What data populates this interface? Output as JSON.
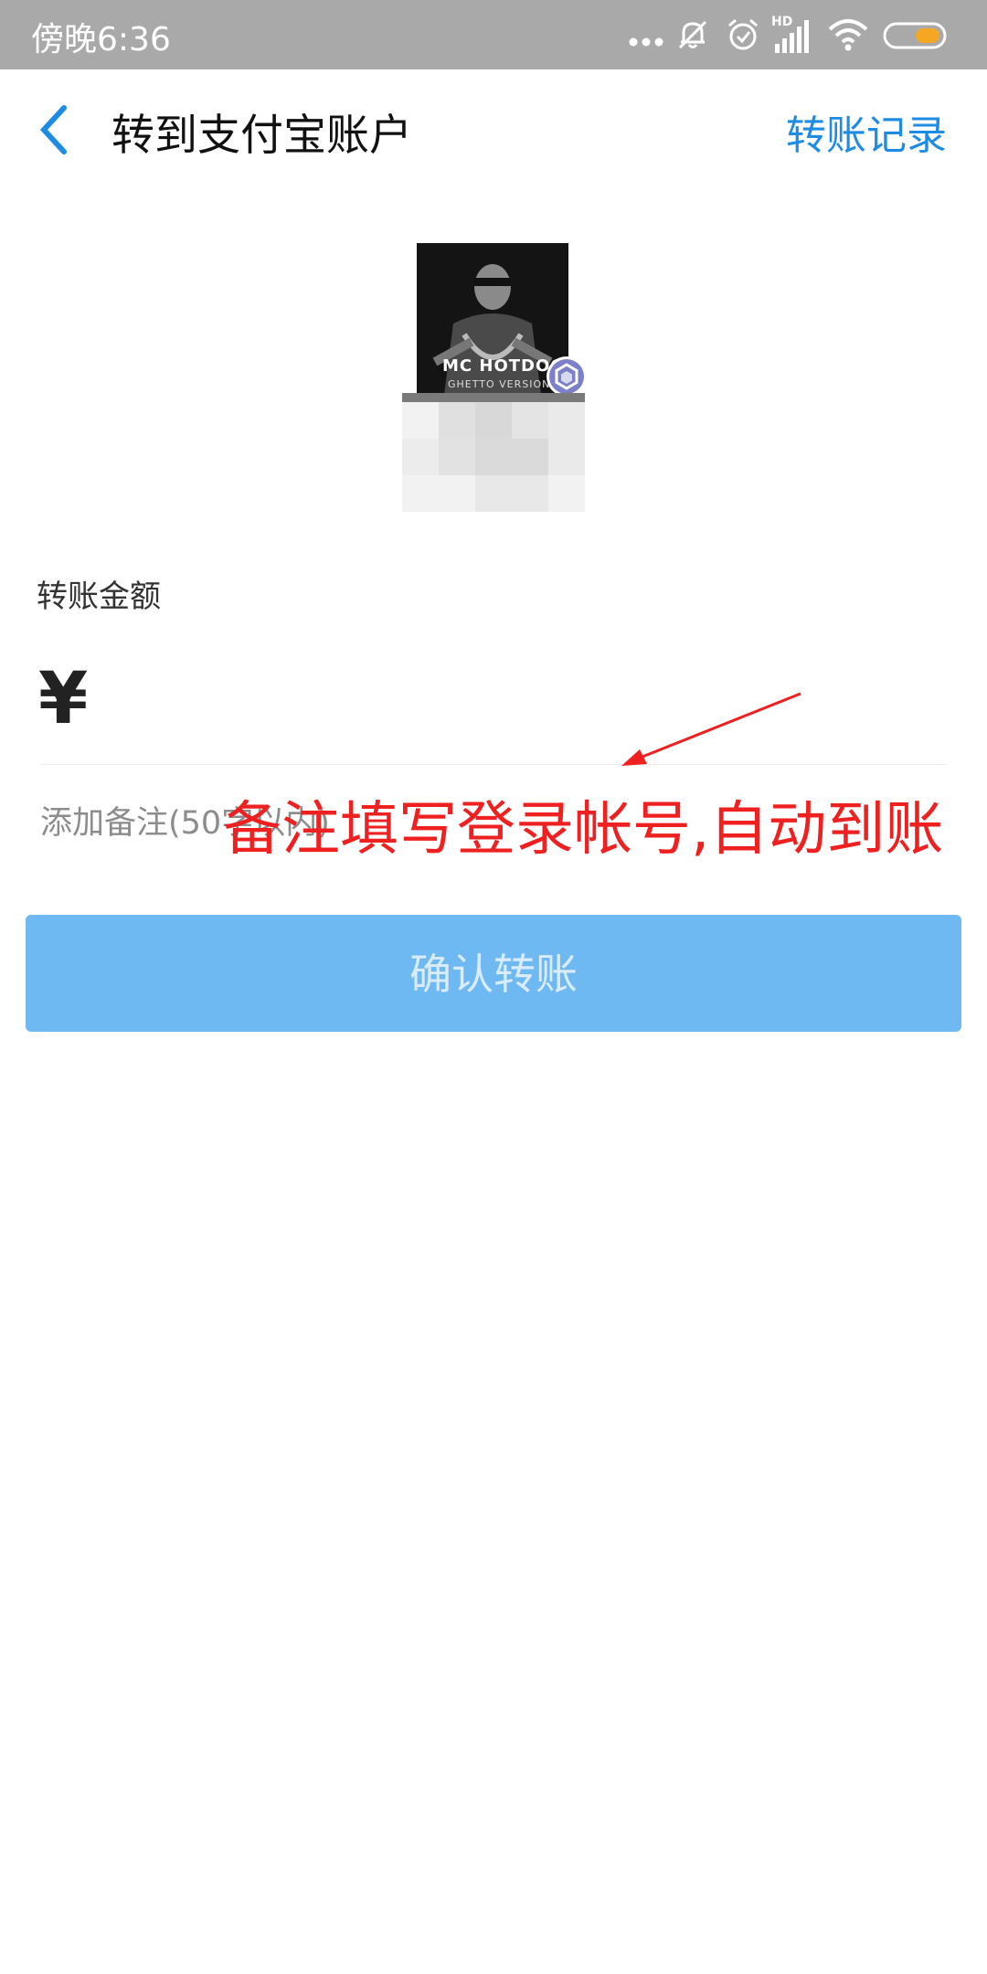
{
  "status_bar": {
    "time": "傍晚6:36",
    "icons": [
      "more-dots-icon",
      "bell-muted-icon",
      "alarm-icon",
      "hd-signal-icon",
      "wifi-icon",
      "battery-icon"
    ],
    "hd_label": "HD"
  },
  "nav": {
    "back_icon": "chevron-left-icon",
    "title": "转到支付宝账户",
    "records_link": "转账记录",
    "accent_color": "#1f8ce3"
  },
  "recipient": {
    "avatar_text_main": "MC HOTDOG",
    "avatar_text_sub": "GHETTO VERSION",
    "badge_icon": "verified-badge-icon"
  },
  "form": {
    "amount_label": "转账金额",
    "currency_symbol": "¥",
    "note_placeholder": "添加备注(50字以内)"
  },
  "annotation": {
    "text": "备注填写登录帐号,自动到账",
    "color": "#ee2020"
  },
  "confirm_button": {
    "label": "确认转账",
    "color": "#6fb9f3"
  }
}
